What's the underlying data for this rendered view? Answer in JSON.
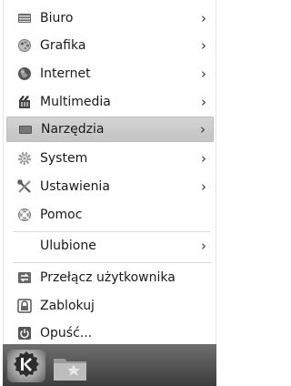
{
  "menu": {
    "items": [
      {
        "label": "Biuro",
        "icon": "office-icon",
        "submenu": true
      },
      {
        "label": "Grafika",
        "icon": "graphics-icon",
        "submenu": true
      },
      {
        "label": "Internet",
        "icon": "internet-globe-icon",
        "submenu": true
      },
      {
        "label": "Multimedia",
        "icon": "multimedia-icon",
        "submenu": true
      },
      {
        "label": "Narzędzia",
        "icon": "utilities-icon",
        "submenu": true,
        "highlighted": true
      },
      {
        "label": "System",
        "icon": "system-gear-icon",
        "submenu": true
      },
      {
        "label": "Ustawienia",
        "icon": "settings-tools-icon",
        "submenu": true
      },
      {
        "label": "Pomoc",
        "icon": "help-lifebuoy-icon",
        "submenu": false
      },
      {
        "label": "Ulubione",
        "icon": "",
        "submenu": true
      },
      {
        "label": "Przełącz użytkownika",
        "icon": "switch-user-icon",
        "submenu": false
      },
      {
        "label": "Zablokuj",
        "icon": "lock-screen-icon",
        "submenu": false
      },
      {
        "label": "Opuść...",
        "icon": "logout-power-icon",
        "submenu": false
      }
    ],
    "submenu_arrow": "›"
  },
  "taskbar": {
    "launcher_icon": "kde-logo-icon",
    "folder_icon": "favorites-folder-icon"
  },
  "colors": {
    "highlight": "#cbcbcb",
    "taskbar": "#4a4a4a"
  }
}
